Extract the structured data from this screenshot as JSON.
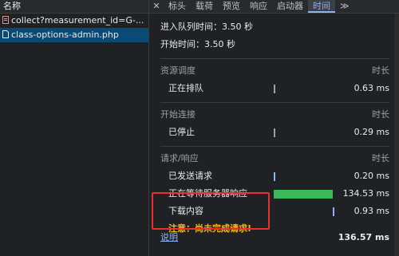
{
  "left_panel": {
    "header": "名称",
    "requests": [
      {
        "name": "collect?measurement_id=G-...",
        "icon": "script-icon"
      },
      {
        "name": "class-options-admin.php",
        "icon": "document-icon",
        "selected": true
      }
    ]
  },
  "tabs": [
    "标头",
    "载荷",
    "预览",
    "响应",
    "启动器",
    "时间",
    "≫"
  ],
  "active_tab": "时间",
  "timing": {
    "queued_label": "进入队列时间：3.50 秒",
    "started_label": "开始时间：3.50 秒",
    "sections": [
      {
        "title": "资源调度",
        "right": "时长",
        "rows": [
          {
            "label": "正在排队",
            "value": "0.63 ms"
          }
        ]
      },
      {
        "title": "开始连接",
        "right": "时长",
        "rows": [
          {
            "label": "已停止",
            "value": "0.29 ms"
          }
        ]
      },
      {
        "title": "请求/响应",
        "right": "时长",
        "rows": [
          {
            "label": "已发送请求",
            "value": "0.20 ms"
          },
          {
            "label": "正在等待服务器响应",
            "value": "134.53 ms"
          },
          {
            "label": "下载内容",
            "value": "0.93 ms"
          }
        ]
      }
    ],
    "warning": "注意：尚未完成请求!",
    "footer_link": "说明",
    "total": "136.57 ms"
  },
  "colors": {
    "waiting_bar": "#3cb95a",
    "accent": "#8ab4f8",
    "warning": "#fbbc04",
    "highlight_box": "#e8302f"
  }
}
